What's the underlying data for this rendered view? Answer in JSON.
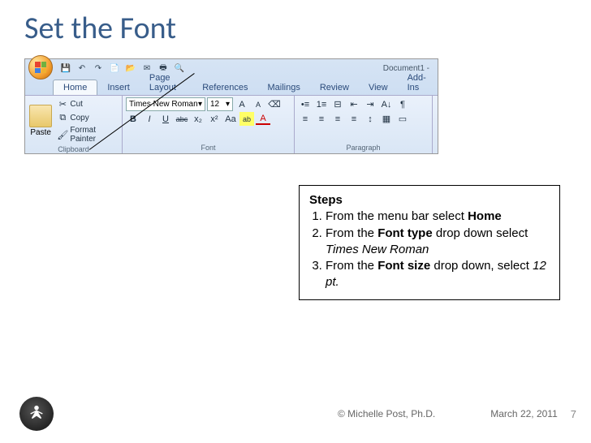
{
  "slide": {
    "title": "Set the Font",
    "copyright": "© Michelle Post, Ph.D.",
    "date": "March 22, 2011",
    "page": "7"
  },
  "ribbon": {
    "doc_title": "Document1 -",
    "qat": {
      "save": "💾",
      "undo": "↶",
      "redo": "↷",
      "new": "📄",
      "open": "📂",
      "mail": "✉",
      "print": "🖶",
      "preview": "🔍"
    },
    "tabs": [
      {
        "label": "Home",
        "active": true
      },
      {
        "label": "Insert"
      },
      {
        "label": "Page Layout"
      },
      {
        "label": "References"
      },
      {
        "label": "Mailings"
      },
      {
        "label": "Review"
      },
      {
        "label": "View"
      },
      {
        "label": "Add-Ins"
      }
    ],
    "clipboard": {
      "label": "Clipboard",
      "paste": "Paste",
      "cut": "Cut",
      "copy": "Copy",
      "painter": "Format Painter"
    },
    "font": {
      "label": "Font",
      "name": "Times New Roman",
      "size": "12",
      "items": {
        "grow": "A▲",
        "shrink": "A▼",
        "clear": "⌫",
        "bold": "B",
        "italic": "I",
        "underline": "U",
        "strike": "abc",
        "sub": "x₂",
        "sup": "x²",
        "case": "Aa",
        "hilite": "ab",
        "color": "A"
      }
    },
    "paragraph": {
      "label": "Paragraph",
      "items": {
        "bullets": "≣",
        "numbers": "≡",
        "multilist": "⊟",
        "outdent": "⇤",
        "indent": "⇥",
        "sort": "A↓",
        "show": "¶",
        "alignL": "≡",
        "alignC": "≡",
        "alignR": "≡",
        "justify": "≡",
        "spacing": "↕",
        "shade": "▦",
        "border": "▭"
      }
    }
  },
  "steps": {
    "header": "Steps",
    "items": [
      {
        "pre": "From the menu bar select ",
        "b1": "Home",
        "post": ""
      },
      {
        "pre": "From the ",
        "b1": "Font type",
        "mid": " drop down select ",
        "i1": "Times New Roman",
        "post": ""
      },
      {
        "pre": "From the ",
        "b1": "Font size",
        "mid": " drop down, select ",
        "i1": "12 pt.",
        "post": ""
      }
    ]
  }
}
